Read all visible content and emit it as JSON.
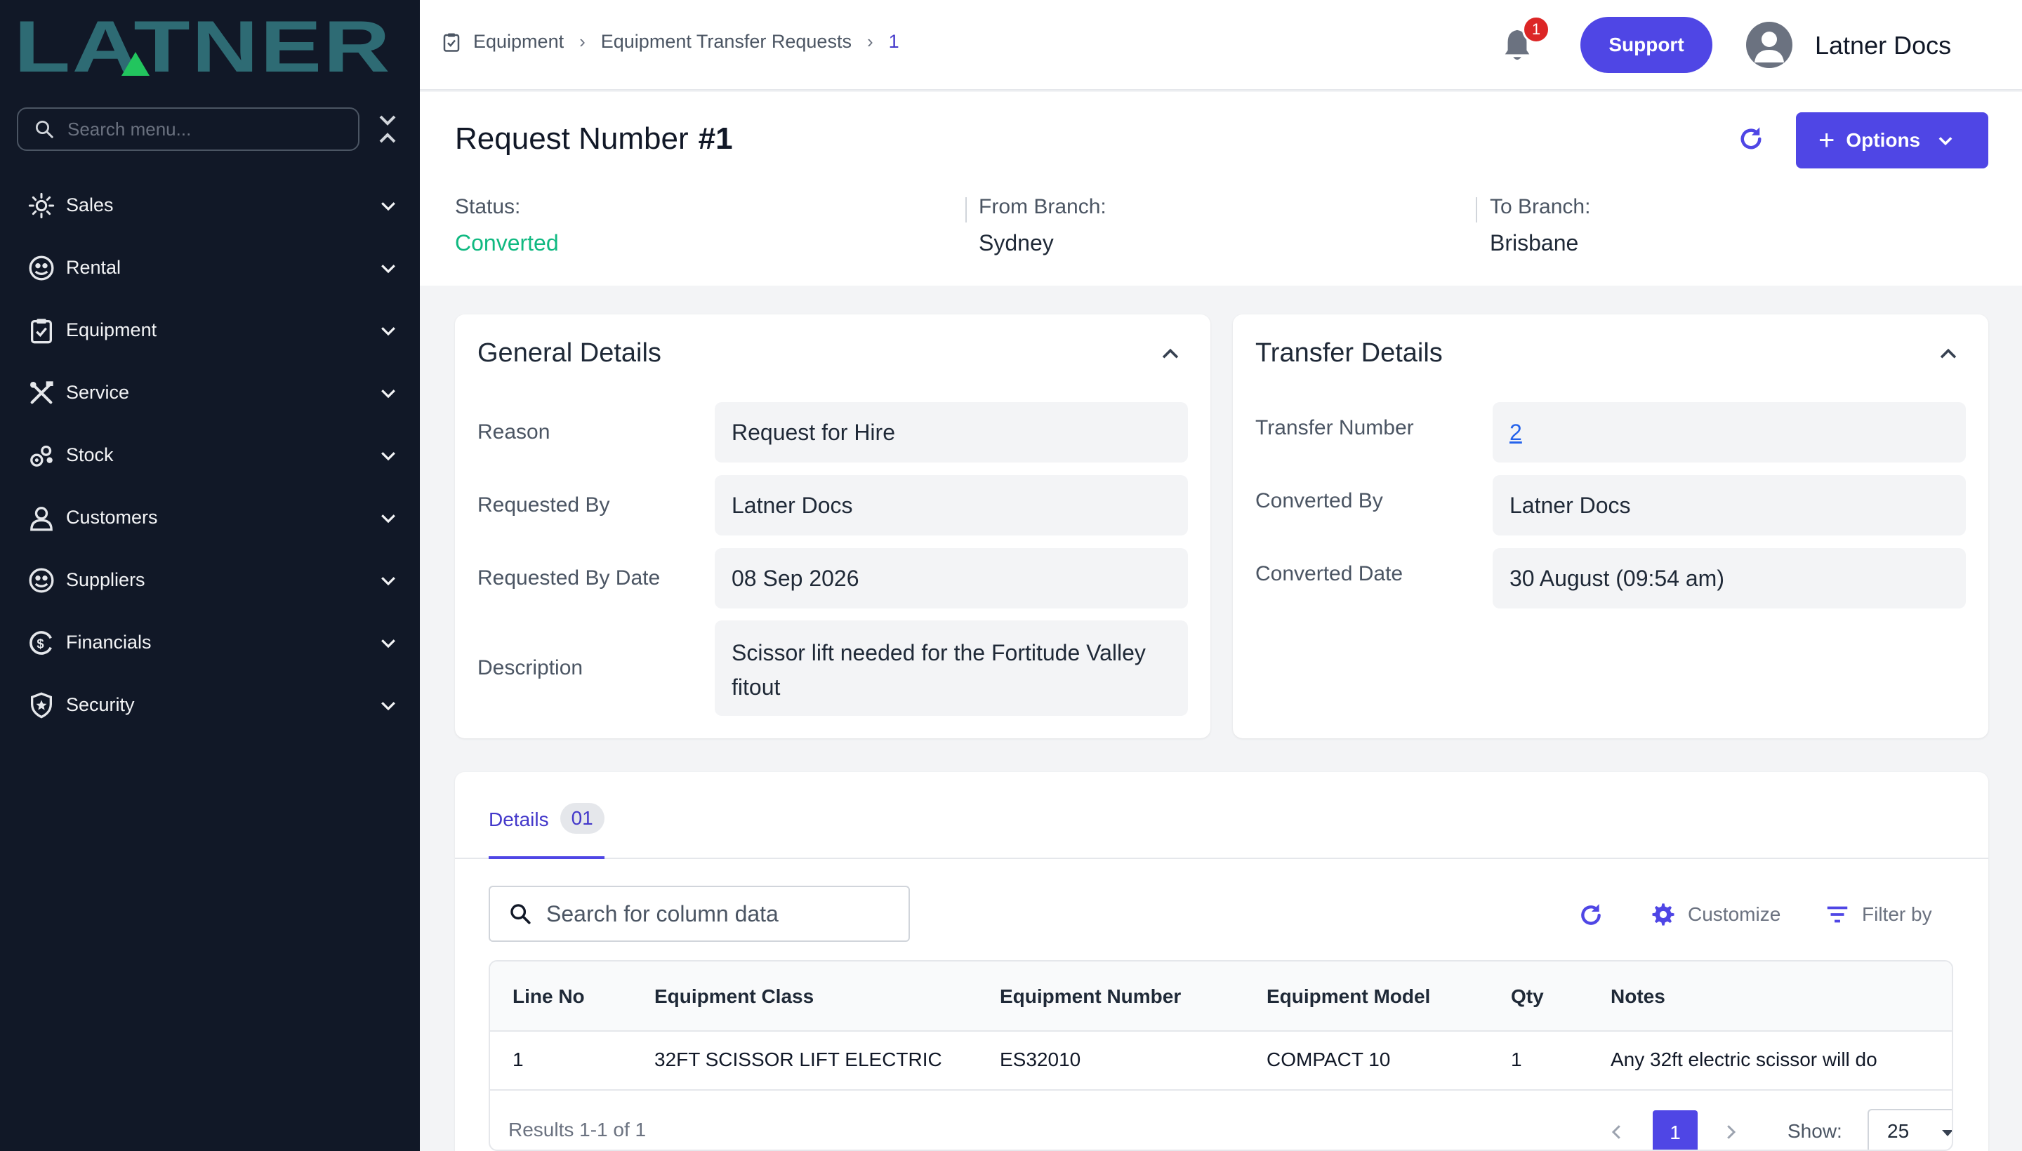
{
  "brand": {
    "name": "LATNER"
  },
  "sidebar": {
    "search_placeholder": "Search menu...",
    "items": [
      {
        "label": "Sales",
        "icon": "sales-icon"
      },
      {
        "label": "Rental",
        "icon": "rental-icon"
      },
      {
        "label": "Equipment",
        "icon": "equipment-icon"
      },
      {
        "label": "Service",
        "icon": "service-icon"
      },
      {
        "label": "Stock",
        "icon": "stock-icon"
      },
      {
        "label": "Customers",
        "icon": "customers-icon"
      },
      {
        "label": "Suppliers",
        "icon": "suppliers-icon"
      },
      {
        "label": "Financials",
        "icon": "financials-icon"
      },
      {
        "label": "Security",
        "icon": "security-icon"
      }
    ]
  },
  "topbar": {
    "breadcrumb": [
      "Equipment",
      "Equipment Transfer Requests",
      "1"
    ],
    "notification_count": "1",
    "support_label": "Support",
    "user_name": "Latner Docs"
  },
  "header": {
    "title_prefix": "Request Number",
    "title_number": "#1",
    "options_label": "Options",
    "status_label": "Status:",
    "status_value": "Converted",
    "from_label": "From Branch:",
    "from_value": "Sydney",
    "to_label": "To Branch:",
    "to_value": "Brisbane"
  },
  "general": {
    "title": "General Details",
    "fields": [
      {
        "label": "Reason",
        "value": "Request for Hire"
      },
      {
        "label": "Requested By",
        "value": "Latner Docs"
      },
      {
        "label": "Requested By Date",
        "value": "08 Sep 2026"
      },
      {
        "label": "Description",
        "value": "Scissor lift needed for the Fortitude Valley fitout"
      }
    ]
  },
  "transfer": {
    "title": "Transfer Details",
    "fields": [
      {
        "label": "Transfer Number",
        "value": "2"
      },
      {
        "label": "Converted By",
        "value": "Latner Docs"
      },
      {
        "label": "Converted Date",
        "value": "30 August (09:54 am)"
      }
    ]
  },
  "table": {
    "tab_label": "Details",
    "tab_count": "01",
    "search_placeholder": "Search for column data",
    "customize_label": "Customize",
    "filter_label": "Filter by",
    "columns": [
      "Line No",
      "Equipment Class",
      "Equipment Number",
      "Equipment Model",
      "Qty",
      "Notes"
    ],
    "rows": [
      [
        "1",
        "32FT SCISSOR LIFT ELECTRIC",
        "ES32010",
        "COMPACT 10",
        "1",
        "Any 32ft electric scissor will do"
      ]
    ],
    "results_text": "Results 1-1 of 1",
    "current_page": "1",
    "show_label": "Show:",
    "page_size": "25"
  },
  "colors": {
    "sidebar_bg": "#111827",
    "accent": "#4f46e5",
    "status_green": "#10b981",
    "logo_teal": "#2e6b74",
    "logo_green": "#22c55e"
  }
}
